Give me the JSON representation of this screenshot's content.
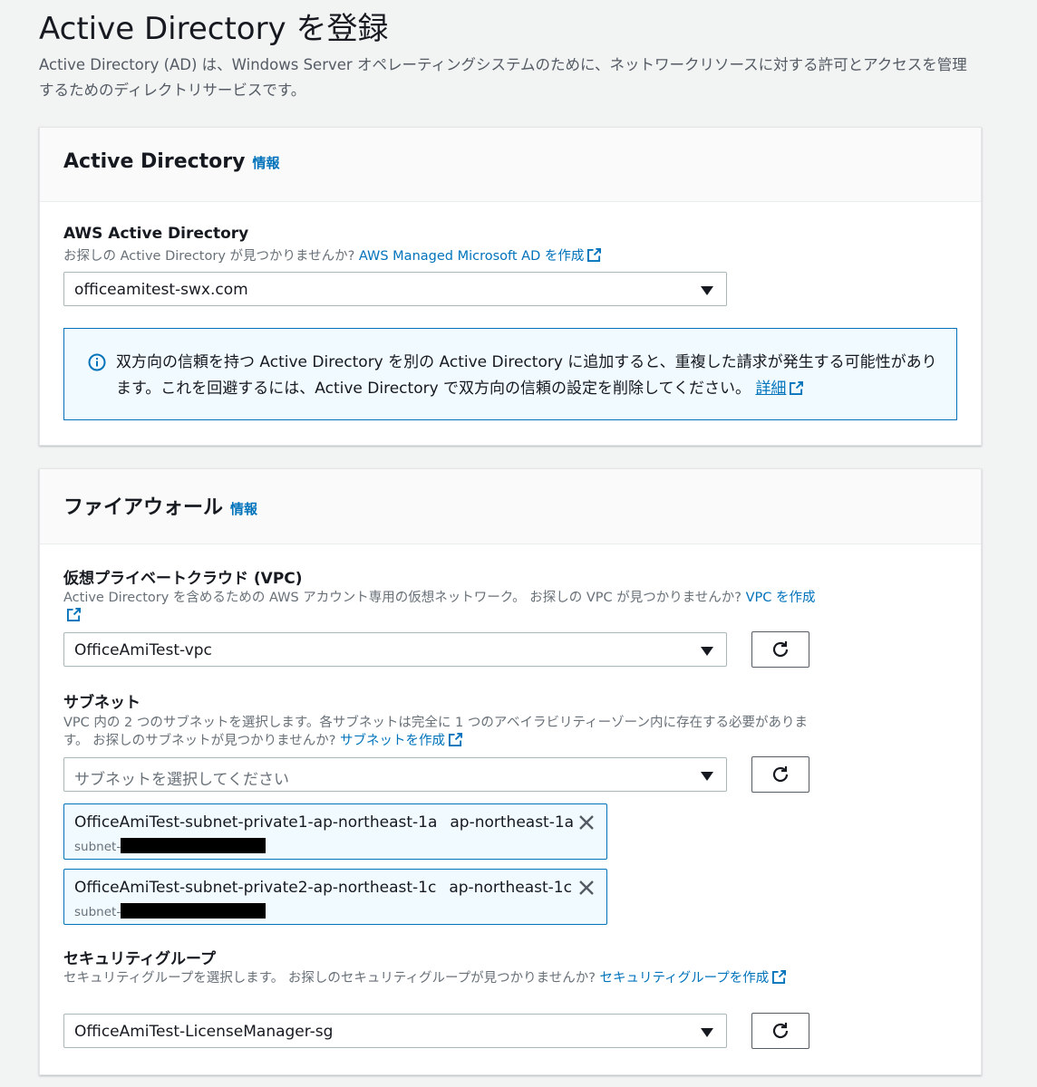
{
  "page": {
    "title": "Active Directory を登録",
    "description": "Active Directory (AD) は、Windows Server オペレーティングシステムのために、ネットワークリソースに対する許可とアクセスを管理するためのディレクトリサービスです。"
  },
  "ad_panel": {
    "title": "Active Directory",
    "info": "情報",
    "field_label": "AWS Active Directory",
    "field_desc": "お探しの Active Directory が見つかりませんか?",
    "create_link": "AWS Managed Microsoft AD を作成",
    "selected": "officeamitest-swx.com",
    "alert_text": "双方向の信頼を持つ Active Directory を別の Active Directory に追加すると、重複した請求が発生する可能性があります。これを回避するには、Active Directory で双方向の信頼の設定を削除してください。",
    "alert_link": "詳細"
  },
  "firewall_panel": {
    "title": "ファイアウォール",
    "info": "情報",
    "vpc": {
      "label": "仮想プライベートクラウド (VPC)",
      "desc": "Active Directory を含めるための AWS アカウント専用の仮想ネットワーク。 お探しの VPC が見つかりませんか?",
      "create_link": "VPC を作成",
      "selected": "OfficeAmiTest-vpc"
    },
    "subnet": {
      "label": "サブネット",
      "desc": "VPC 内の 2 つのサブネットを選択します。各サブネットは完全に 1 つのアベイラビリティーゾーン内に存在する必要があります。 お探しのサブネットが見つかりませんか?",
      "create_link": "サブネットを作成",
      "placeholder": "サブネットを選択してください",
      "tokens": [
        {
          "name": "OfficeAmiTest-subnet-private1-ap-northeast-1a",
          "az": "ap-northeast-1a",
          "id_prefix": "subnet-"
        },
        {
          "name": "OfficeAmiTest-subnet-private2-ap-northeast-1c",
          "az": "ap-northeast-1c",
          "id_prefix": "subnet-"
        }
      ]
    },
    "security_group": {
      "label": "セキュリティグループ",
      "desc": "セキュリティグループを選択します。 お探しのセキュリティグループが見つかりませんか?",
      "create_link": "セキュリティグループを作成",
      "selected": "OfficeAmiTest-LicenseManager-sg"
    }
  },
  "colors": {
    "link": "#0073bb",
    "info_bg": "#f1faff",
    "page_bg": "#f2f3f3"
  },
  "icons": [
    "external-link-icon",
    "info-circle-icon",
    "caret-down-icon",
    "refresh-icon",
    "close-icon"
  ]
}
